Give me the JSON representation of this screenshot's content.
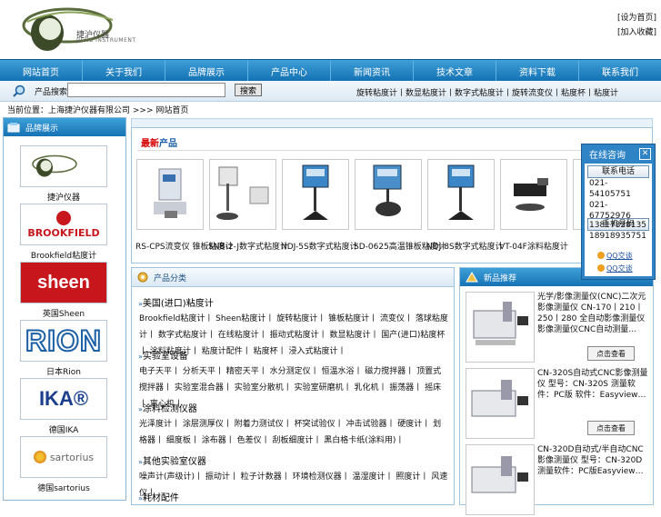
{
  "header": {
    "logo_cn": "捷沪仪器",
    "logo_en": "JIEHU INSTRUMENT",
    "links": [
      "[设为首页]",
      "[加入收藏]"
    ]
  },
  "nav": [
    "网站首页",
    "关于我们",
    "品牌展示",
    "产品中心",
    "新闻资讯",
    "技术文章",
    "资料下载",
    "联系我们"
  ],
  "search": {
    "label": "产品搜索",
    "placeholder": "",
    "button": "搜索",
    "quick_links": "旋转粘度计丨数显粘度计丨数字式粘度计丨旋转流变仪丨粘度杯丨粘度计"
  },
  "breadcrumb": "当前位置：上海捷沪仪器有限公司 >>> 网站首页",
  "sidebar": {
    "title": "品牌展示",
    "brands": [
      {
        "label": "捷沪仪器",
        "logo": "JIEHU INSTRUMENT"
      },
      {
        "label": "Brookfield粘度计",
        "logo": "BROOKFIELD"
      },
      {
        "label": "英国Sheen",
        "logo": "sheen"
      },
      {
        "label": "日本Rion",
        "logo": "RION"
      },
      {
        "label": "德国IKA",
        "logo": "IKA®"
      },
      {
        "label": "德国sartorius",
        "logo": "sartorius"
      }
    ]
  },
  "latest": {
    "title_red": "最新",
    "title_blue": "产品",
    "products": [
      "RS-CPS流变仪 锥板粘度计",
      "SNB-2-J数字式粘度计",
      "NDJ-5S数字式粘度计",
      "SD-0625高温锥板粘度计",
      "NDJ-8S数字式粘度计",
      "VT-04F涂料粘度计"
    ]
  },
  "category": {
    "title": "产品分类",
    "groups": [
      {
        "title": "美国(进口)粘度计",
        "items": "Brookfield粘度计丨 Sheen粘度计丨 旋转粘度计丨 锥板粘度计丨 流变仪丨 落球粘度计丨 数字式粘度计丨 在线粘度计丨 振动式粘度计丨 数显粘度计丨 国产(进口)粘度杯丨 涂料粘度计丨 粘度计配件丨 粘度杯丨 浸入式粘度计丨"
      },
      {
        "title": "实验室设备",
        "items": "电子天平丨 分析天平丨 精密天平丨 水分测定仪丨 恒温水浴丨 磁力搅拌器丨 顶置式搅拌器丨 实验室混合器丨 实验室分散机丨 实验室研磨机丨 乳化机丨 振荡器丨 摇床丨 离心机丨"
      },
      {
        "title": "涂料检测仪器",
        "items": "光泽度计丨 涂层测厚仪丨 附着力测试仪丨 杯突试验仪丨 冲击试验器丨 硬度计丨 划格器丨 细度板丨 涂布器丨 色差仪丨 刮板细度计丨 黑白格卡纸(涂料用)丨"
      },
      {
        "title": "其他实验室仪器",
        "items": "噪声计(声级计)丨 振动计丨 粒子计数器丨 环境检测仪器丨 温湿度计丨 照度计丨 风速仪丨"
      },
      {
        "title": "耗材配件",
        "items": ""
      }
    ]
  },
  "newprod": {
    "title": "新品推荐",
    "items": [
      {
        "text": "光学/影像测量仪(CNC)二次元影像测量仪 CN-170丨210丨250丨280 全自动影像测量仪影像测量仪CNC自动测量…",
        "button": "点击查看"
      },
      {
        "text": "CN-320S自动式CNC影像测量仪 型号：CN-320S 测量软件：PC版 软件：Easyview…",
        "button": "点击查看"
      },
      {
        "text": "CN-320D自动式/半自动CNC影像测量仪 型号：CN-320D 测量软件：PC版Easyview…",
        "button": "点击查看"
      }
    ]
  },
  "consult": {
    "title": "在线咨询",
    "close": "✕",
    "tab_phone": "联系电话",
    "phones": [
      "021-",
      "54105751",
      "021-",
      "67752976"
    ],
    "tab_mobile": "手机号码",
    "mobiles": [
      "13817828135",
      "18918935751"
    ],
    "qq": [
      "QQ交谈",
      "QQ交谈"
    ]
  },
  "colors": {
    "nav_blue": "#1270b3",
    "accent_red": "#d40000",
    "panel_blue": "#2f84c6"
  }
}
